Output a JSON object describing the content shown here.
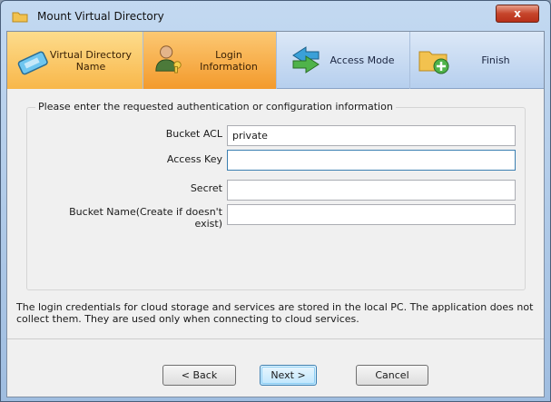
{
  "window": {
    "title": "Mount Virtual Directory",
    "close_label": "x"
  },
  "steps": [
    {
      "label": "Virtual Directory Name",
      "icon": "card-icon",
      "state": "done"
    },
    {
      "label": "Login Information",
      "icon": "user-key-icon",
      "state": "active"
    },
    {
      "label": "Access Mode",
      "icon": "arrows-icon",
      "state": "pending"
    },
    {
      "label": "Finish",
      "icon": "folder-plus-icon",
      "state": "pending"
    }
  ],
  "form": {
    "legend": "Please enter the requested authentication or configuration information",
    "fields": [
      {
        "label": "Bucket ACL",
        "value": "private"
      },
      {
        "label": "Access Key",
        "value": ""
      },
      {
        "label": "Secret",
        "value": ""
      },
      {
        "label": "Bucket Name(Create if doesn't exist)",
        "value": ""
      }
    ]
  },
  "info_text": "The login credentials for cloud storage and services are stored in the local PC. The application does not collect them. They are used only when connecting to cloud services.",
  "buttons": {
    "back": "< Back",
    "next": "Next >",
    "cancel": "Cancel"
  }
}
